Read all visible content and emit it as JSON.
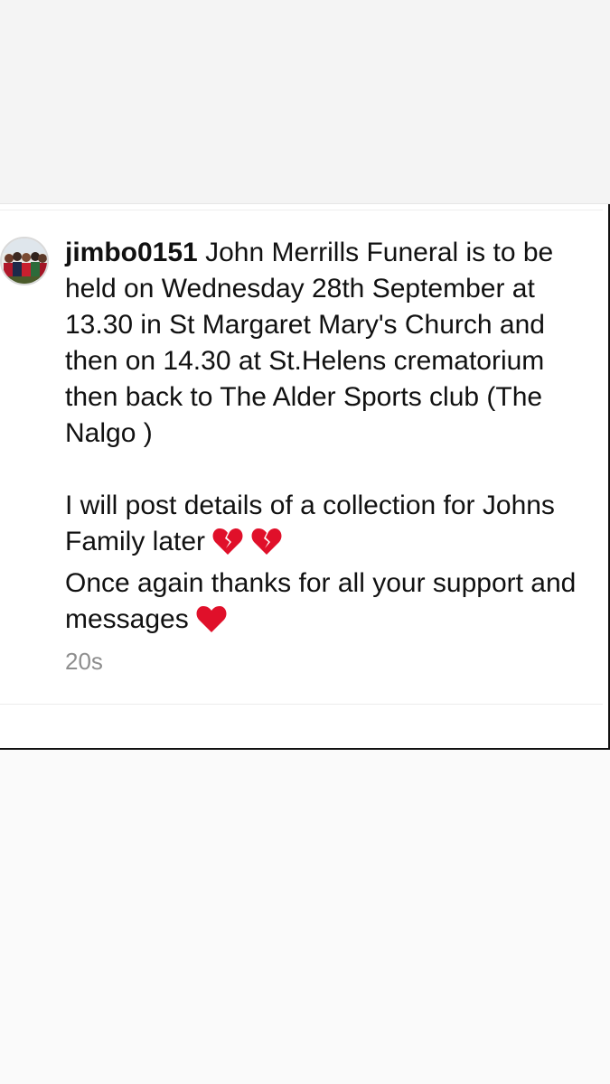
{
  "comment": {
    "username": "jimbo0151",
    "paragraph1": " John Merrills Funeral is to be held on Wednesday 28th September at 13.30 in St Margaret Mary's Church and then on 14.30 at St.Helens crematorium then back to The Alder Sports club (The Nalgo )",
    "paragraph2": "I will post details of a collection for Johns Family later",
    "paragraph3": "Once again thanks for all your support and messages",
    "timestamp": "20s"
  },
  "icons": {
    "avatar": "profile-photo-group",
    "broken_heart": "broken-heart-emoji",
    "heart": "red-heart-emoji"
  },
  "colors": {
    "text": "#111111",
    "timestamp": "#8e8e8e",
    "heart": "#e0102a"
  }
}
